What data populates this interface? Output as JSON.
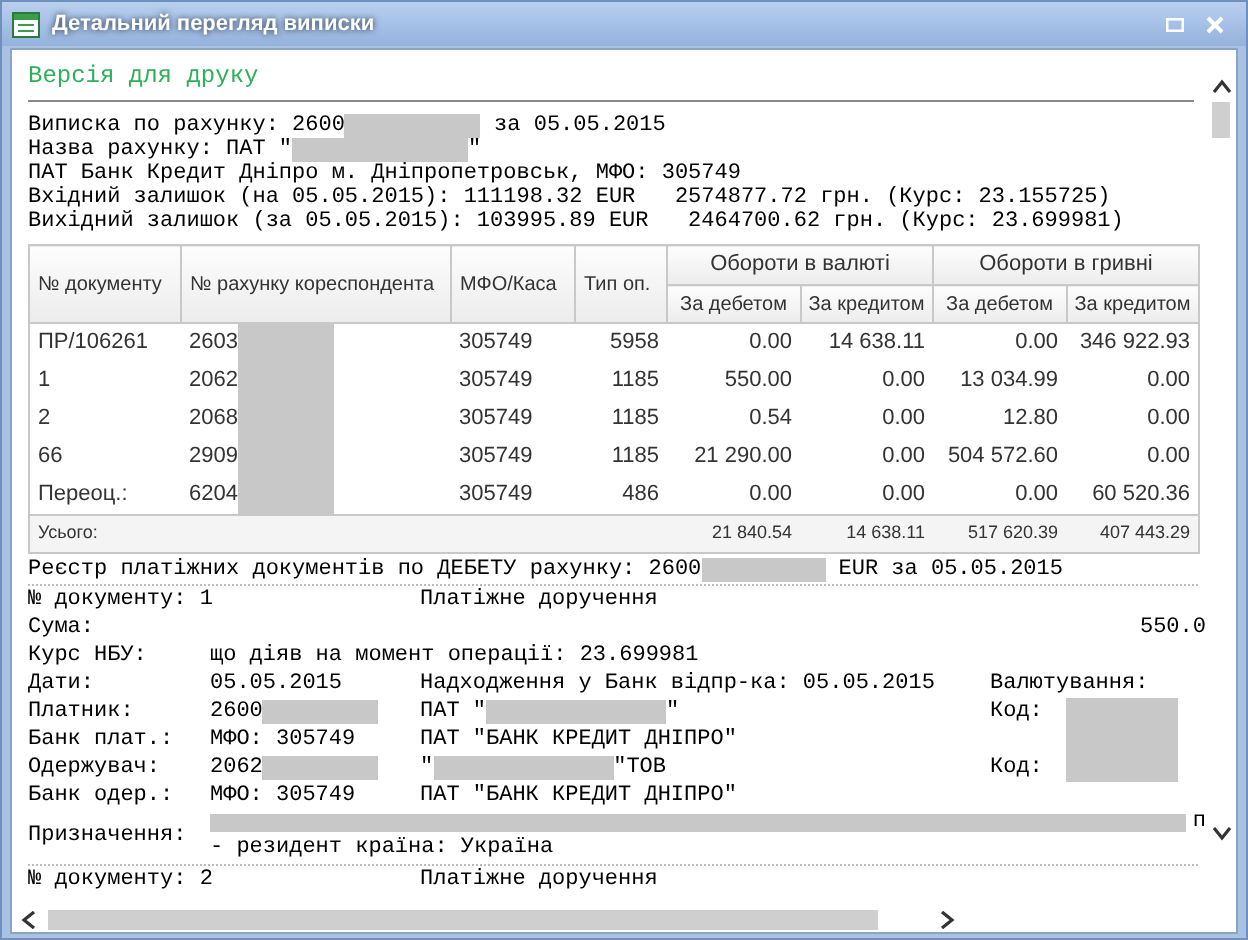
{
  "window": {
    "title": "Детальний перегляд виписки"
  },
  "print_link": "Версія для друку",
  "header_lines": [
    {
      "text": "Виписка по рахунку: 2600",
      "redacted": true,
      "after": " за 05.05.2015"
    },
    {
      "text": "Назва рахунку: ПАТ \"",
      "redacted": true,
      "after": "\""
    },
    {
      "text": "ПАТ Банк Кредит Дніпро м. Дніпропетровськ, МФО: 305749"
    },
    {
      "text": "Вхідний залишок (на 05.05.2015): 111198.32 EUR   2574877.72 грн. (Курс: 23.155725)"
    },
    {
      "text": "Вихідний залишок (за 05.05.2015): 103995.89 EUR   2464700.62 грн. (Курс: 23.699981)"
    }
  ],
  "table": {
    "columns": [
      "№ документу",
      "№ рахунку кореспондента",
      "МФО/Каса",
      "Тип оп."
    ],
    "groups": [
      {
        "title": "Обороти в валюті",
        "columns": [
          "За дебетом",
          "За кредитом"
        ]
      },
      {
        "title": "Обороти в гривні",
        "columns": [
          "За дебетом",
          "За кредитом"
        ]
      }
    ],
    "rows": [
      {
        "document": "ПР/106261",
        "account": "2603",
        "redacted": true,
        "mfo": "305749",
        "type": "5958",
        "values": [
          "0.00",
          "14 638.11",
          "0.00",
          "346 922.93"
        ]
      },
      {
        "document": "1",
        "account": "2062",
        "redacted": true,
        "mfo": "305749",
        "type": "1185",
        "values": [
          "550.00",
          "0.00",
          "13 034.99",
          "0.00"
        ]
      },
      {
        "document": "2",
        "account": "2068",
        "redacted": true,
        "mfo": "305749",
        "type": "1185",
        "values": [
          "0.54",
          "0.00",
          "12.80",
          "0.00"
        ]
      },
      {
        "document": "66",
        "account": "2909",
        "redacted": true,
        "mfo": "305749",
        "type": "1185",
        "values": [
          "21 290.00",
          "0.00",
          "504 572.60",
          "0.00"
        ]
      },
      {
        "document": "Переоц.:",
        "account": "6204",
        "redacted": true,
        "mfo": "305749",
        "type": "486",
        "values": [
          "0.00",
          "0.00",
          "0.00",
          "60 520.36"
        ]
      }
    ],
    "totals": {
      "label": "Усього:",
      "values": [
        "21 840.54",
        "14 638.11",
        "517 620.39",
        "407 443.29"
      ]
    }
  },
  "register": {
    "text": "Реєстр платіжних документів по ДЕБЕТУ рахунку: 2600",
    "redacted": true,
    "after": " EUR за 05.05.2015"
  },
  "documents": [
    {
      "number_label": "№ документу: 1",
      "doc_type": "Платіжне доручення",
      "rows": [
        {
          "kind": "amount",
          "label": "Сума:",
          "value": "550.0"
        },
        {
          "kind": "wide",
          "label": "Курс НБУ:",
          "value": "що діяв на момент операції: 23.699981"
        },
        {
          "kind": "fields",
          "label": "Дати:",
          "value": "05.05.2015",
          "middle": "Надходження у Банк відпр-ка: 05.05.2015",
          "right": "Валютування:"
        },
        {
          "kind": "fields",
          "label": "Платник:",
          "value": "2600",
          "value_redacted": true,
          "middle": "ПАТ \"",
          "middle_redacted": true,
          "middle_after": "\"",
          "right": "Код:",
          "right_redacted": true
        },
        {
          "kind": "fields",
          "label": "Банк плат.:",
          "value": "МФО: 305749",
          "middle": "ПАТ \"БАНК КРЕДИТ ДНІПРО\"",
          "right_redacted": true
        },
        {
          "kind": "fields",
          "label": "Одержувач:",
          "value": "2062",
          "value_redacted": true,
          "middle": "\"",
          "middle_redacted": true,
          "middle_after": "\"ТОВ",
          "right": "Код:",
          "right_redacted": true
        },
        {
          "kind": "fields",
          "label": "Банк одер.:",
          "value": "МФО: 305749",
          "middle": "ПАТ \"БАНК КРЕДИТ ДНІПРО\""
        },
        {
          "kind": "purpose",
          "label": "Призначення:",
          "redacted": true,
          "tail": "п",
          "value": "- резидент країна: Україна"
        }
      ]
    },
    {
      "number_label": "№ документу: 2",
      "doc_type": "Платіжне доручення"
    }
  ]
}
